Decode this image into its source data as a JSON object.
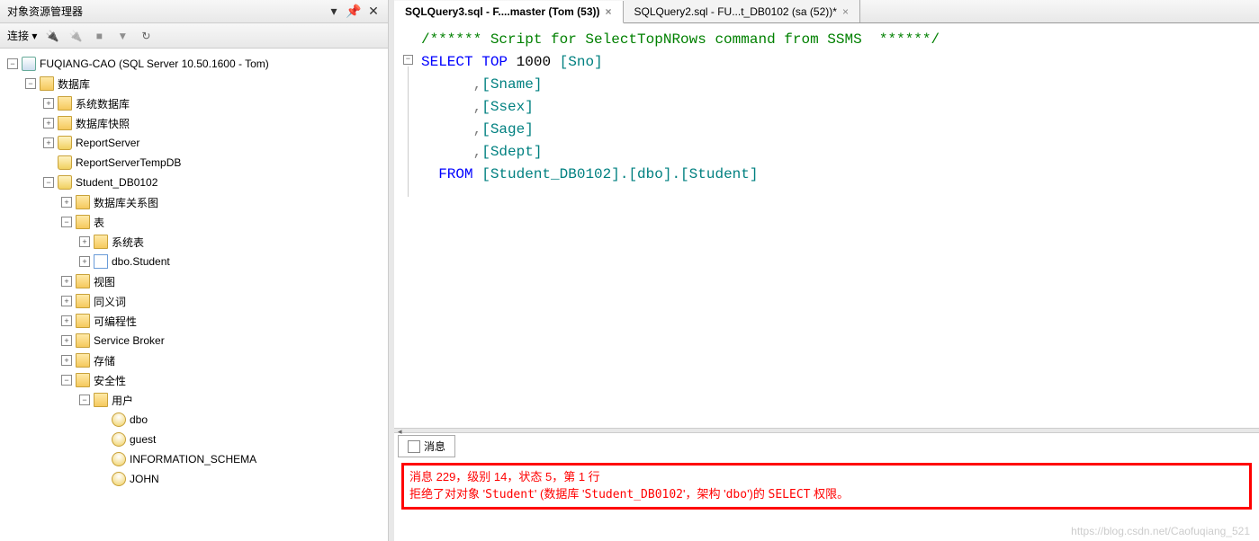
{
  "panel": {
    "title": "对象资源管理器",
    "connectLabel": "连接 ▾"
  },
  "tree": {
    "root": "FUQIANG-CAO (SQL Server 10.50.1600 - Tom)",
    "databases": "数据库",
    "sysDatabases": "系统数据库",
    "dbSnapshots": "数据库快照",
    "reportServer": "ReportServer",
    "reportServerTempDB": "ReportServerTempDB",
    "studentDb": "Student_DB0102",
    "dbDiagrams": "数据库关系图",
    "tables": "表",
    "sysTables": "系统表",
    "dboStudent": "dbo.Student",
    "views": "视图",
    "synonyms": "同义词",
    "programmability": "可编程性",
    "serviceBroker": "Service Broker",
    "storage": "存储",
    "security": "安全性",
    "users": "用户",
    "dbo": "dbo",
    "guest": "guest",
    "infoSchema": "INFORMATION_SCHEMA",
    "john": "JOHN"
  },
  "tabs": {
    "active": "SQLQuery3.sql - F....master (Tom (53))",
    "inactive": "SQLQuery2.sql - FU...t_DB0102 (sa (52))*"
  },
  "code": {
    "l1": "/****** Script for SelectTopNRows command from SSMS  ******/",
    "l2a": "SELECT",
    "l2b": "TOP",
    "l2c": "1000",
    "l2d": "[Sno]",
    "l3": ",[Sname]",
    "l4": ",[Ssex]",
    "l5": ",[Sage]",
    "l6": ",[Sdept]",
    "l7a": "FROM",
    "l7b": "[Student_DB0102].[dbo].[Student]"
  },
  "result": {
    "tabLabel": "消息",
    "err1": "消息 229，级别 14，状态 5，第 1 行",
    "err2a": "拒绝了对对象 '",
    "err2b": "Student",
    "err2c": "' (数据库 '",
    "err2d": "Student_DB0102",
    "err2e": "'，架构 '",
    "err2f": "dbo",
    "err2g": "')的 ",
    "err2h": "SELECT",
    "err2i": " 权限。"
  },
  "watermark": "https://blog.csdn.net/Caofuqiang_521"
}
